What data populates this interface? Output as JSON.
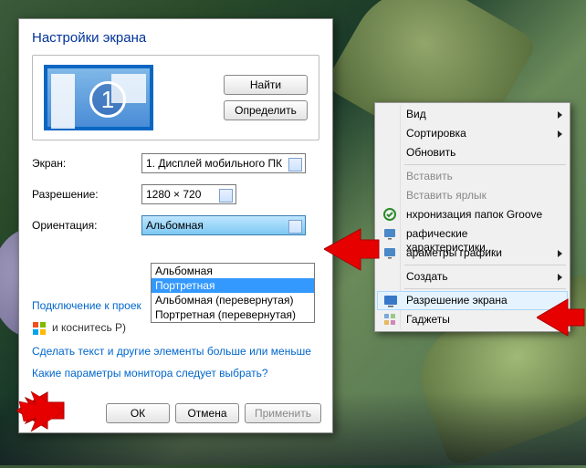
{
  "dialog": {
    "title": "Настройки экрана",
    "monitor_number": "1",
    "find_btn": "Найти",
    "detect_btn": "Определить",
    "screen_label": "Экран:",
    "screen_value": "1. Дисплей мобильного ПК",
    "resolution_label": "Разрешение:",
    "resolution_value": "1280 × 720",
    "orientation_label": "Ориентация:",
    "orientation_value": "Альбомная",
    "orientation_options": [
      "Альбомная",
      "Портретная",
      "Альбомная (перевернутая)",
      "Портретная (перевернутая)"
    ],
    "projector_link": "Подключение к проек",
    "projector_note": "и коснитесь Р)",
    "textsize_link": "Сделать текст и другие элементы больше или меньше",
    "which_link": "Какие параметры монитора следует выбрать?",
    "ok": "ОК",
    "cancel": "Отмена",
    "apply": "Применить"
  },
  "context_menu": {
    "view": "Вид",
    "sort": "Сортировка",
    "refresh": "Обновить",
    "paste": "Вставить",
    "paste_shortcut": "Вставить ярлык",
    "groove": "нхронизация папок Groove",
    "gfx_props": "рафические характеристики...",
    "gfx_params": "араметры графики",
    "create": "Создать",
    "resolution": "Разрешение экрана",
    "gadgets": "Гаджеты"
  }
}
